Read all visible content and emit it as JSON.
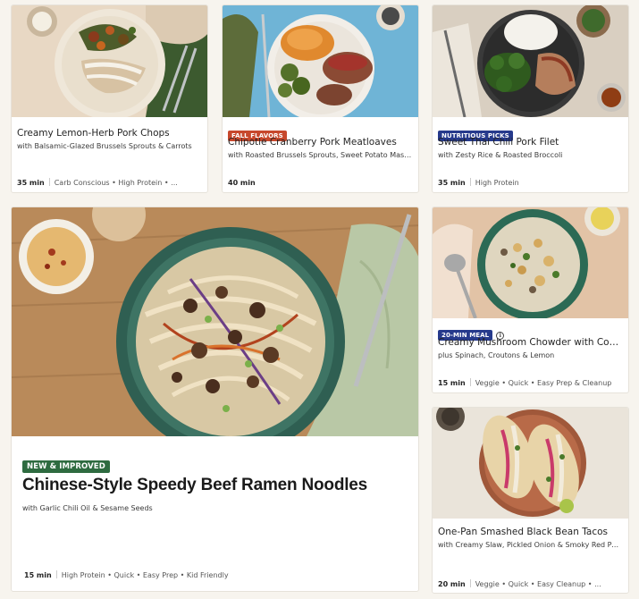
{
  "recipes": [
    {
      "title": "Creamy Lemon-Herb Pork Chops",
      "subtitle": "with Balsamic-Glazed Brussels Sprouts & Carrots",
      "time": "35 min",
      "tags": "Carb Conscious • High Protein • ..."
    },
    {
      "badge": "FALL FLAVORS",
      "title": "Chipotle Cranberry Pork Meatloaves",
      "subtitle": "with Roasted Brussels Sprouts, Sweet Potato Mash & Gravy",
      "time": "40 min",
      "tags": ""
    },
    {
      "badge": "NUTRITIOUS PICKS",
      "title": "Sweet Thai Chili Pork Filet",
      "subtitle": "with Zesty Rice & Roasted Broccoli",
      "time": "35 min",
      "tags": "High Protein"
    },
    {
      "badge": "NEW & IMPROVED",
      "title": "Chinese-Style Speedy Beef Ramen Noodles",
      "subtitle": "with Garlic Chili Oil & Sesame Seeds",
      "time": "15 min",
      "tags": "High Protein • Quick • Easy Prep • Kid Friendly"
    },
    {
      "badge": "20-MIN MEAL",
      "title": "Creamy Mushroom Chowder with Couscous",
      "subtitle": "plus Spinach, Croutons & Lemon",
      "time": "15 min",
      "tags": "Veggie • Quick • Easy Prep & Cleanup"
    },
    {
      "title": "One-Pan Smashed Black Bean Tacos",
      "subtitle": "with Creamy Slaw, Pickled Onion & Smoky Red Pepper Crema",
      "time": "20 min",
      "tags": "Veggie • Quick • Easy Cleanup • ..."
    }
  ],
  "colors": {
    "badge_orange": "#c7482c",
    "badge_blue": "#263a8c",
    "badge_green": "#2e6b40"
  },
  "icons": {
    "info": "info-icon"
  }
}
